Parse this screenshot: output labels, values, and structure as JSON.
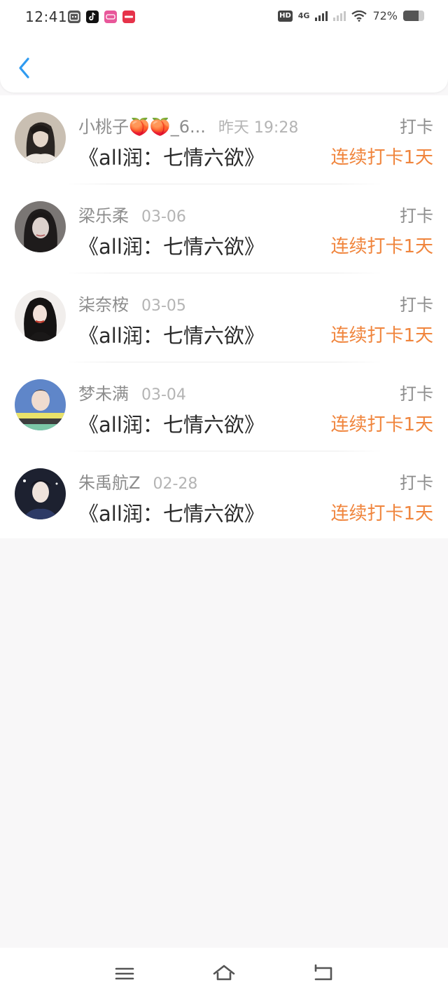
{
  "status_bar": {
    "time": "12:41",
    "app_icons": [
      {
        "name": "cat-app-icon",
        "color": "#555555"
      },
      {
        "name": "tiktok-icon",
        "color": "#111111"
      },
      {
        "name": "lofter-icon",
        "color": "#e8579a"
      },
      {
        "name": "xiaohongshu-icon",
        "color": "#e6334a"
      }
    ],
    "hd_badge": "HD",
    "network": "4G",
    "battery_text": "72%",
    "battery_level": 0.72
  },
  "header": {
    "back_icon": "chevron-left-icon",
    "accent_color": "#2f9bf0"
  },
  "records": [
    {
      "name": "小桃子🍑🍑_6...",
      "time": "昨天 19:28",
      "action": "打卡",
      "title": "《all润：七情六欲》",
      "streak": "连续打卡1天"
    },
    {
      "name": "梁乐柔",
      "time": "03-06",
      "action": "打卡",
      "title": "《all润：七情六欲》",
      "streak": "连续打卡1天"
    },
    {
      "name": "柒奈桉",
      "time": "03-05",
      "action": "打卡",
      "title": "《all润：七情六欲》",
      "streak": "连续打卡1天"
    },
    {
      "name": "梦未满",
      "time": "03-04",
      "action": "打卡",
      "title": "《all润：七情六欲》",
      "streak": "连续打卡1天"
    },
    {
      "name": "朱禹航Z",
      "time": "02-28",
      "action": "打卡",
      "title": "《all润：七情六欲》",
      "streak": "连续打卡1天"
    }
  ],
  "colors": {
    "streak": "#f0853d",
    "name": "#8d8d8d",
    "title": "#2b2b2b"
  },
  "nav_bar": {
    "icons": [
      "menu-icon",
      "home-icon",
      "back-icon"
    ]
  }
}
